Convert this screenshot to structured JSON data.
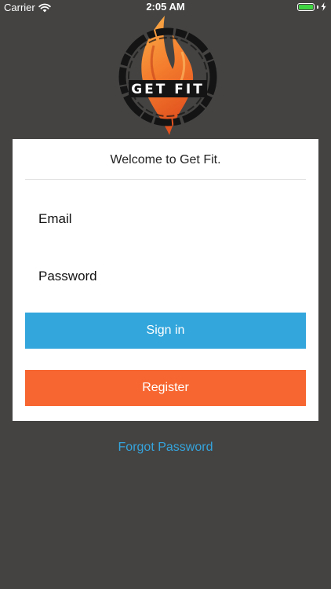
{
  "status_bar": {
    "carrier": "Carrier",
    "time": "2:05 AM",
    "battery_color": "#3fd442"
  },
  "logo": {
    "text": "GET FIT",
    "icon": "flame-logo-icon"
  },
  "card": {
    "welcome": "Welcome to Get Fit.",
    "email_placeholder": "Email",
    "email_value": "",
    "password_placeholder": "Password",
    "password_value": "",
    "signin_label": "Sign in",
    "register_label": "Register"
  },
  "forgot_password": "Forgot Password",
  "colors": {
    "background": "#444342",
    "signin": "#33a6dc",
    "register": "#f76630",
    "link": "#35a4dc"
  }
}
